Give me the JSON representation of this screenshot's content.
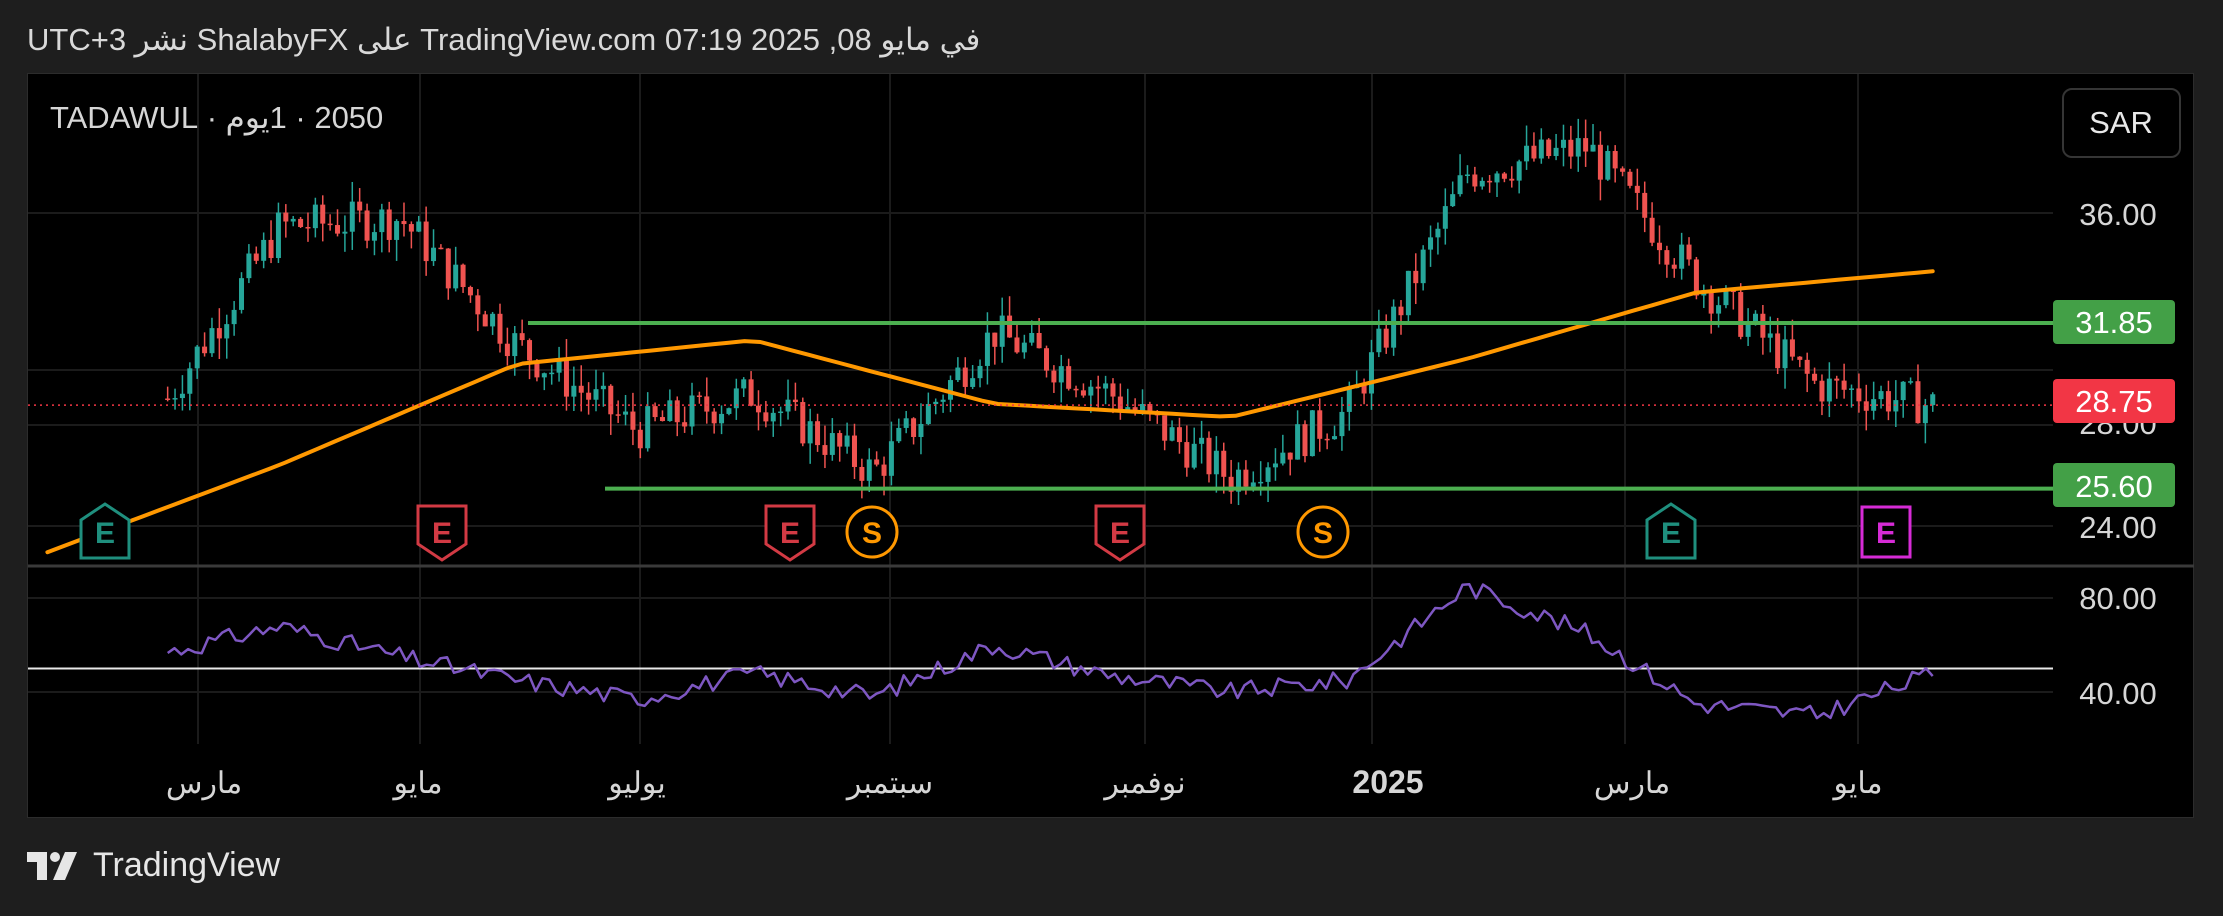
{
  "header": {
    "text": "UTC+3 نشر ShalabyFX على TradingView.com 07:19 2025 ,08 في مايو"
  },
  "symbol_label": "2050 · 1يوم · TADAWUL",
  "currency_button": "SAR",
  "footer": {
    "brand": "TradingView"
  },
  "colors": {
    "up": "#26a69a",
    "down": "#ef5350",
    "ma": "#ff9800",
    "level": "#4caf50",
    "price_tag": "#f23645",
    "rsi": "#7e57c2",
    "background": "#000000"
  },
  "chart_data": [
    {
      "type": "candlestick",
      "title": "2050 · 1يوم · TADAWUL",
      "currency": "SAR",
      "ylim": [
        23,
        40
      ],
      "y_ticks": [
        "36.00",
        "28.00",
        "24.00"
      ],
      "price_tags": [
        {
          "label": "31.85",
          "value": 31.85,
          "kind": "level"
        },
        {
          "label": "28.75",
          "value": 28.75,
          "kind": "last"
        },
        {
          "label": "25.60",
          "value": 25.6,
          "kind": "level"
        }
      ],
      "x_ticks": [
        "مارس",
        "مايو",
        "يوليو",
        "سبتمبر",
        "نوفمبر",
        "2025",
        "مارس",
        "مايو"
      ],
      "series": [
        {
          "name": "",
          "kind": "close",
          "dates": [
            "2024-02",
            "2024-03",
            "2024-04",
            "2024-05",
            "2024-06",
            "2024-07",
            "2024-08",
            "2024-09",
            "2024-10",
            "2024-11",
            "2024-12",
            "2025-01",
            "2025-02",
            "2025-03",
            "2025-04",
            "2025-05"
          ],
          "values": [
            29.0,
            35.5,
            35.8,
            31.0,
            27.8,
            29.2,
            26.2,
            31.5,
            29.2,
            26.0,
            28.5,
            37.5,
            38.5,
            33.5,
            29.5,
            28.75
          ]
        },
        {
          "name": "",
          "kind": "moving_average",
          "dates": [
            "2024-01",
            "2024-03",
            "2024-05",
            "2024-07",
            "2024-09",
            "2024-11",
            "2025-01",
            "2025-03",
            "2025-05"
          ],
          "values": [
            23.2,
            26.5,
            30.3,
            31.2,
            28.8,
            28.3,
            30.5,
            33.0,
            33.8
          ]
        }
      ],
      "horizontal_lines": [
        {
          "label": "31.85",
          "value": 31.85
        },
        {
          "label": "25.60",
          "value": 25.6
        }
      ],
      "event_markers": [
        "E",
        "E",
        "E",
        "S",
        "E",
        "S",
        "E",
        "E"
      ],
      "last_price_line": 28.75
    },
    {
      "type": "line",
      "ylim": [
        20,
        90
      ],
      "y_ticks": [
        "80.00",
        "40.00"
      ],
      "reference_line": 50,
      "series": [
        {
          "name": "",
          "dates": [
            "2024-02",
            "2024-03",
            "2024-04",
            "2024-05",
            "2024-06",
            "2024-07",
            "2024-08",
            "2024-09",
            "2024-10",
            "2024-11",
            "2024-12",
            "2025-01",
            "2025-02",
            "2025-03",
            "2025-04",
            "2025-05"
          ],
          "values": [
            57,
            68,
            55,
            45,
            37,
            48,
            38,
            60,
            47,
            40,
            45,
            85,
            65,
            35,
            30,
            48
          ]
        }
      ]
    }
  ]
}
